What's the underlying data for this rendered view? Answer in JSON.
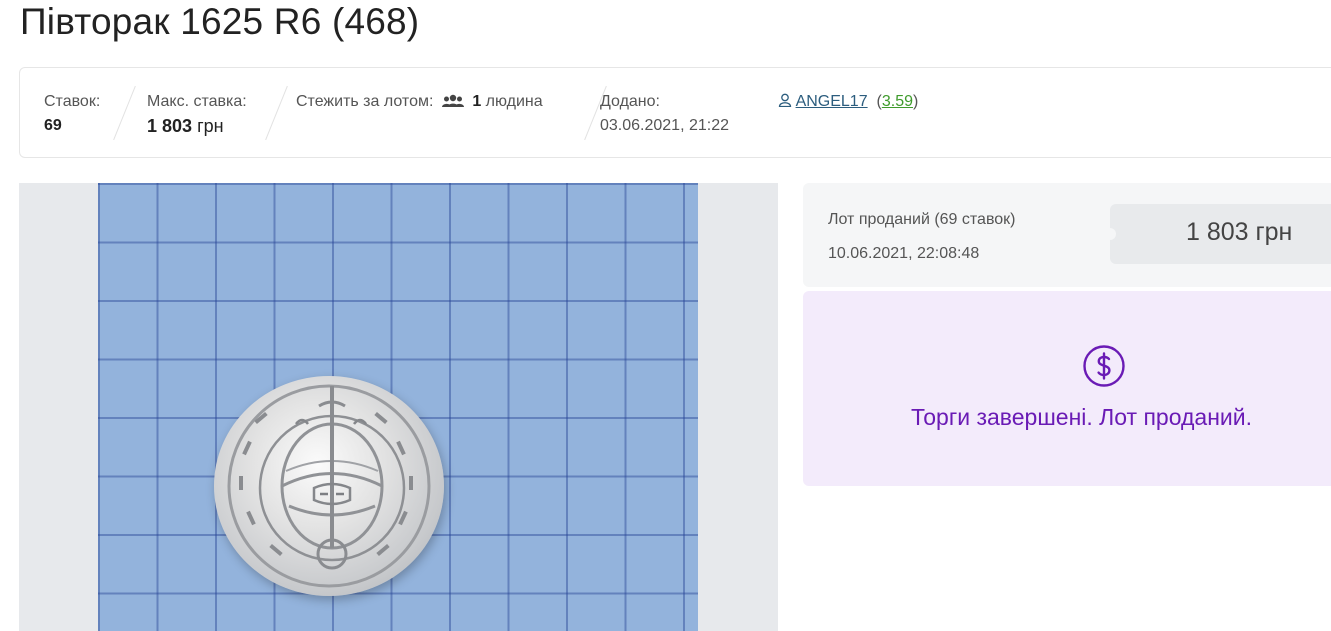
{
  "title": "Півторак 1625 R6 (468)",
  "stats": {
    "bids_label": "Ставок:",
    "bids_value": "69",
    "max_bid_label": "Макс. ставка:",
    "max_bid_amount": "1 803",
    "max_bid_currency": "грн",
    "watch_label": "Стежить за лотом:",
    "watch_icon": "people-icon",
    "watch_count": "1",
    "watch_unit": "людина",
    "added_label": "Додано:",
    "added_value": "03.06.2021, 21:22"
  },
  "seller": {
    "icon": "user-icon",
    "name": "ANGEL17",
    "rating": "3.59"
  },
  "status": {
    "sold_label": "Лот проданий (69 ставок)",
    "sold_time": "10.06.2021, 22:08:48",
    "price": "1 803 грн"
  },
  "closed": {
    "icon": "dollar-circle-icon",
    "message": "Торги завершені. Лот проданий."
  },
  "colors": {
    "accent_purple": "#6a1bb5",
    "closed_bg": "#f3ebfb",
    "link_blue": "#2c5d7e",
    "rating_green": "#3f9b2c"
  }
}
